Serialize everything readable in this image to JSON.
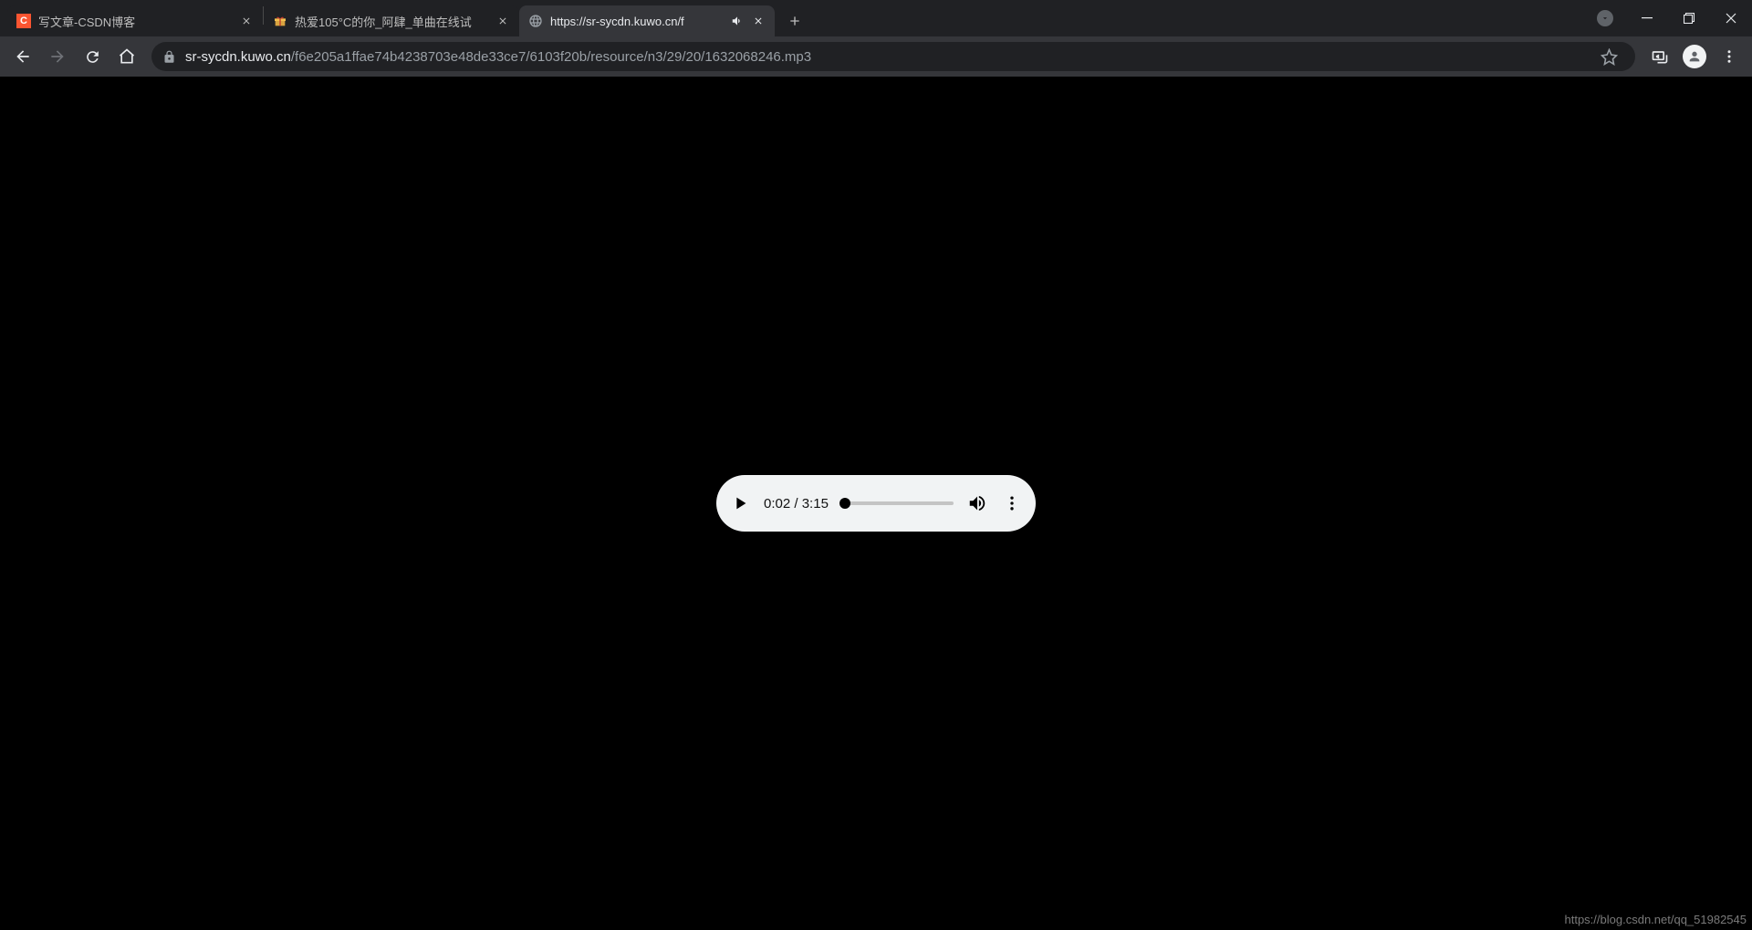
{
  "tabs": [
    {
      "title": "写文章-CSDN博客",
      "favicon": "csdn",
      "active": false,
      "audio": false
    },
    {
      "title": "热爱105°C的你_阿肆_单曲在线试",
      "favicon": "gift",
      "active": false,
      "audio": false
    },
    {
      "title": "https://sr-sycdn.kuwo.cn/f",
      "favicon": "globe",
      "active": true,
      "audio": true
    }
  ],
  "url": {
    "host": "sr-sycdn.kuwo.cn",
    "path": "/f6e205a1ffae74b4238703e48de33ce7/6103f20b/resource/n3/29/20/1632068246.mp3"
  },
  "player": {
    "current": "0:02",
    "duration": "3:15"
  },
  "watermark": "https://blog.csdn.net/qq_51982545",
  "favicon_csdn_letter": "C"
}
